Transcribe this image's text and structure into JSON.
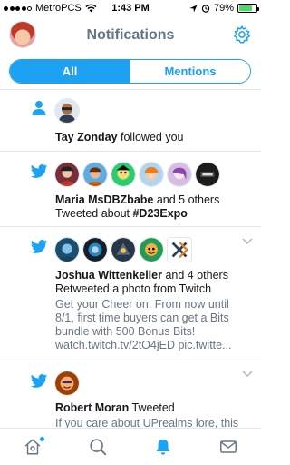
{
  "status_bar": {
    "carrier": "MetroPCS",
    "time": "1:43 PM",
    "battery_percent": "79%",
    "battery_level": 0.79,
    "signal_bars_filled": 4,
    "signal_bars_total": 5
  },
  "header": {
    "title": "Notifications",
    "settings_icon": "gear-icon"
  },
  "tabs_segment": {
    "all_label": "All",
    "mentions_label": "Mentions",
    "active": "All"
  },
  "notifications": [
    {
      "type": "follow",
      "icon": "person-icon",
      "actor": "Tay Zonday",
      "text": " followed you"
    },
    {
      "type": "tweet",
      "icon": "twitter-bird-icon",
      "actor": "Maria MsDBZbabe",
      "text": " and 5 others",
      "line2_prefix": "Tweeted about ",
      "hashtag": "#D23Expo",
      "avatar_count": 6
    },
    {
      "type": "retweet",
      "icon": "twitter-bird-icon",
      "actor": "Joshua Wittenkeller",
      "text": " and 4 others",
      "line2": "Retweeted a photo from Twitch",
      "body_lines": [
        "Get your Cheer on. From now until",
        "8/1, first time buyers can get a Bits",
        "bundle with 500 Bonus Bits!",
        "watch.twitch.tv/2tO4jED pic.twitte..."
      ],
      "avatar_count": 5
    },
    {
      "type": "tweet",
      "icon": "twitter-bird-icon",
      "actor": "Robert Moran",
      "text": " Tweeted",
      "body_lines": [
        "If you care about UPrealms lore, this"
      ]
    }
  ],
  "bottom_tabs": [
    {
      "name": "home",
      "icon": "home-icon"
    },
    {
      "name": "search",
      "icon": "search-icon"
    },
    {
      "name": "notifications",
      "icon": "bell-icon",
      "active": true
    },
    {
      "name": "messages",
      "icon": "mail-icon"
    }
  ],
  "colors": {
    "accent": "#1da1f2",
    "secondary_text": "#657786",
    "divider": "#e1e8ed"
  }
}
